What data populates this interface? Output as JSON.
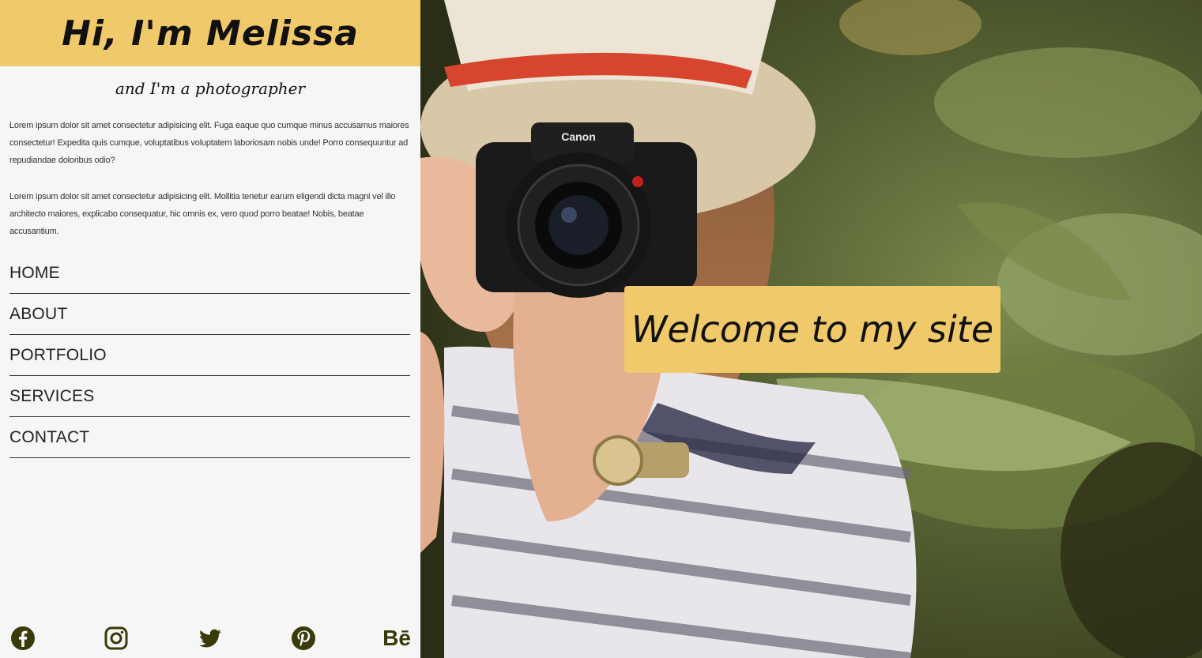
{
  "sidebar": {
    "title": "Hi, I'm Melissa",
    "subtitle": "and I'm a photographer",
    "bio": [
      "Lorem ipsum dolor sit amet consectetur adipisicing elit. Fuga eaque quo cumque minus accusamus maiores consectetur! Expedita quis cumque, voluptatibus voluptatem laboriosam nobis unde! Porro consequuntur ad repudiandae doloribus odio?",
      "Lorem ipsum dolor sit amet consectetur adipisicing elit. Mollitia tenetur earum eligendi dicta magni vel illo architecto maiores, explicabo consequatur, hic omnis ex, vero quod porro beatae! Nobis, beatae accusantium."
    ],
    "nav": [
      "HOME",
      "ABOUT",
      "PORTFOLIO",
      "SERVICES",
      "CONTACT"
    ],
    "socials": [
      {
        "icon": "facebook-icon"
      },
      {
        "icon": "instagram-icon"
      },
      {
        "icon": "twitter-icon"
      },
      {
        "icon": "pinterest-icon"
      },
      {
        "icon": "behance-icon",
        "text": "Bē"
      }
    ]
  },
  "hero": {
    "welcome_text": "Welcome to my site",
    "camera_brand": "Canon"
  },
  "colors": {
    "accent": "#f0c96a",
    "icon": "#3a3a0a",
    "sidebar_bg": "#f6f6f6"
  }
}
